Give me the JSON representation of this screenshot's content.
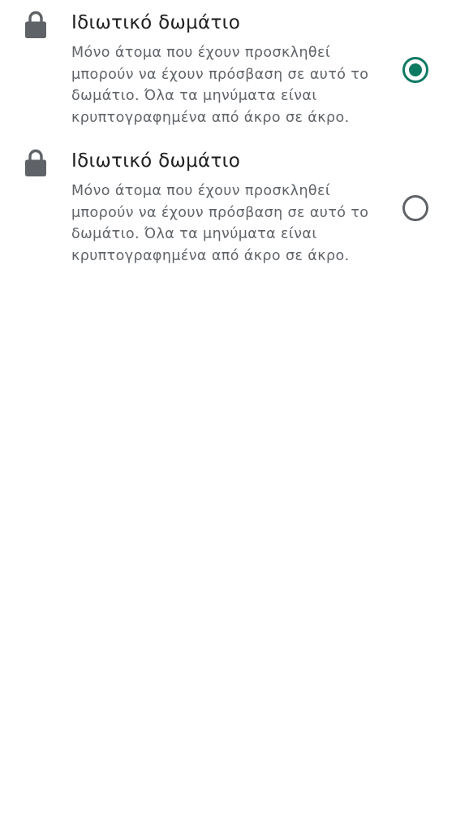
{
  "colors": {
    "accent": "#0d7a62",
    "title_text": "#1f1f1f",
    "secondary_text": "#5f6368",
    "icon": "#5f6368"
  },
  "options": [
    {
      "icon": "lock-icon",
      "title": "Ιδιωτικό δωμάτιο",
      "description_lines": [
        "Μόνο άτομα που έχουν προσκληθεί",
        "μπορούν να έχουν πρόσβαση σε αυτό το",
        "δωμάτιο. Όλα τα μηνύματα είναι",
        "κρυπτογραφημένα από άκρο σε άκρο."
      ],
      "selected": true
    },
    {
      "icon": "lock-icon",
      "title": "Ιδιωτικό δωμάτιο",
      "description_lines": [
        "Μόνο άτομα που έχουν προσκληθεί",
        "μπορούν να έχουν πρόσβαση σε αυτό το",
        "δωμάτιο. Όλα τα μηνύματα είναι",
        "κρυπτογραφημένα από άκρο σε άκρο."
      ],
      "selected": false
    }
  ]
}
